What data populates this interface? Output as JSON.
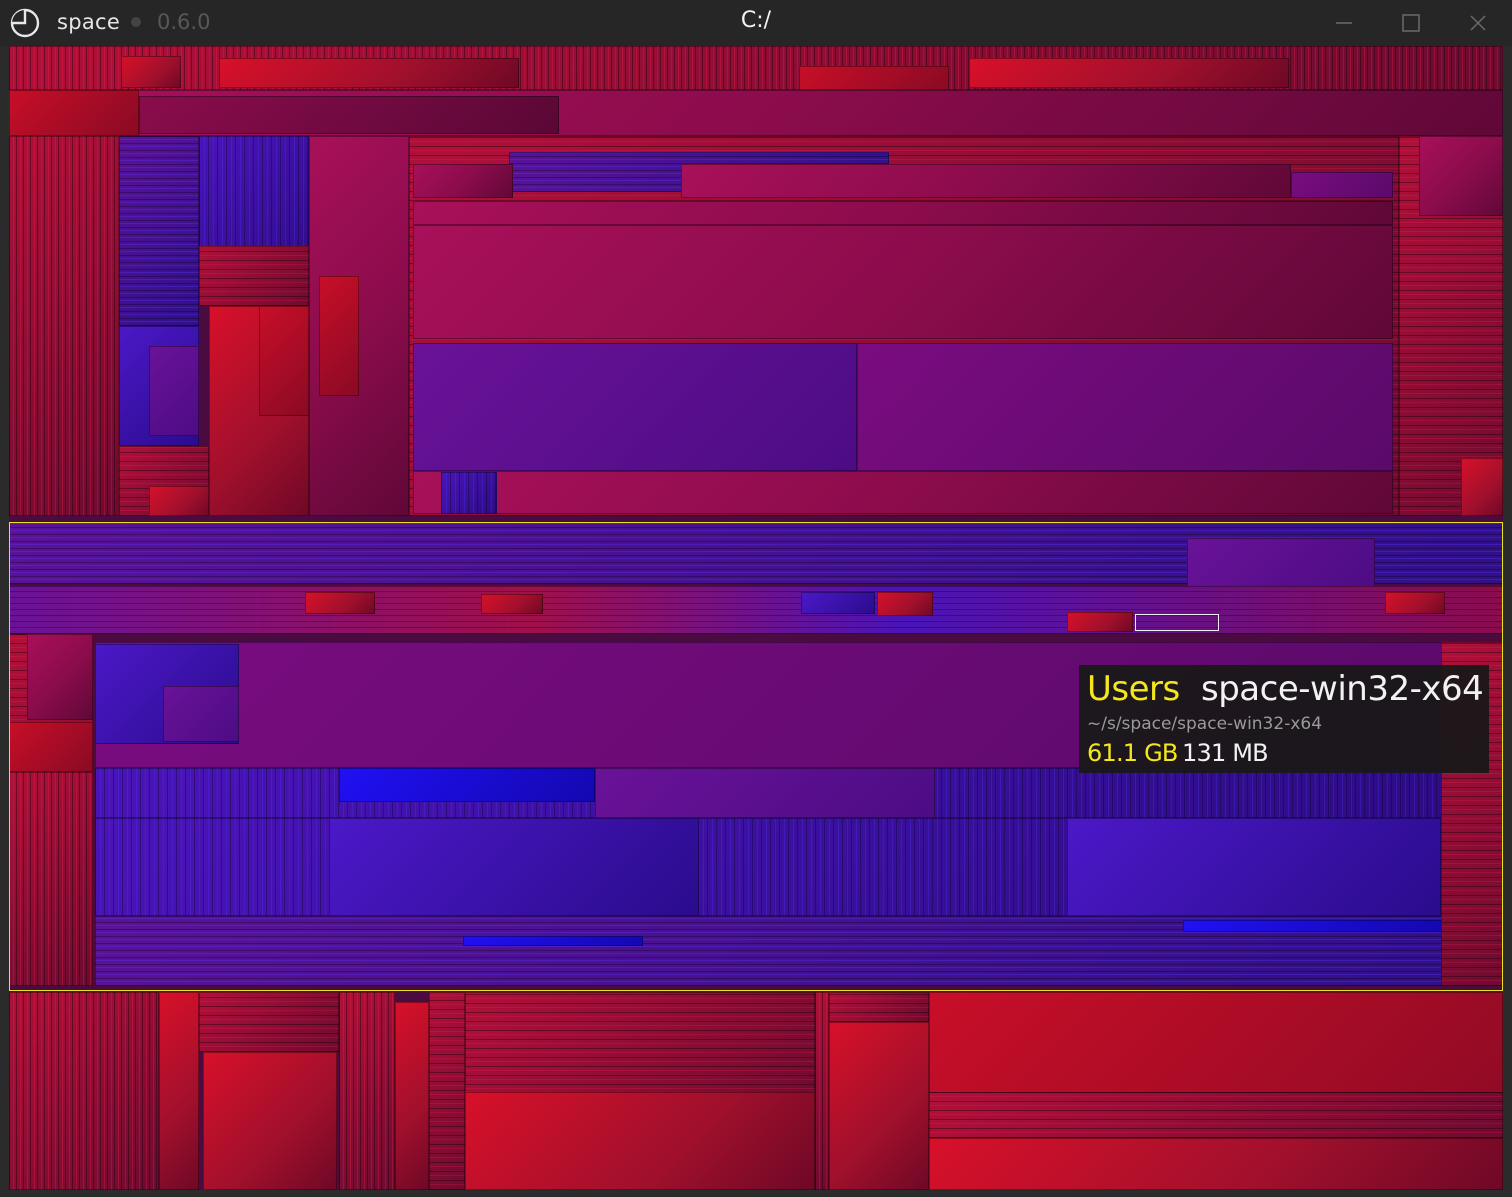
{
  "window": {
    "app_name": "space",
    "version": "0.6.0",
    "current_path": "C:/"
  },
  "controls": {
    "minimize_icon": "minimize-icon",
    "maximize_icon": "maximize-icon",
    "close_icon": "close-icon"
  },
  "tooltip": {
    "parent": "Users",
    "name": "space-win32-x64",
    "path": "~/s/space/space-win32-x64",
    "parent_size": "61.1 GB",
    "item_size": "131 MB"
  },
  "colors": {
    "highlight": "#e7e21c",
    "tooltip_parent": "#f5e71c",
    "titlebar": "#262626",
    "file_large": "#d8102a",
    "file_mid": "#a8105a",
    "file_small": "#4c18c8"
  }
}
